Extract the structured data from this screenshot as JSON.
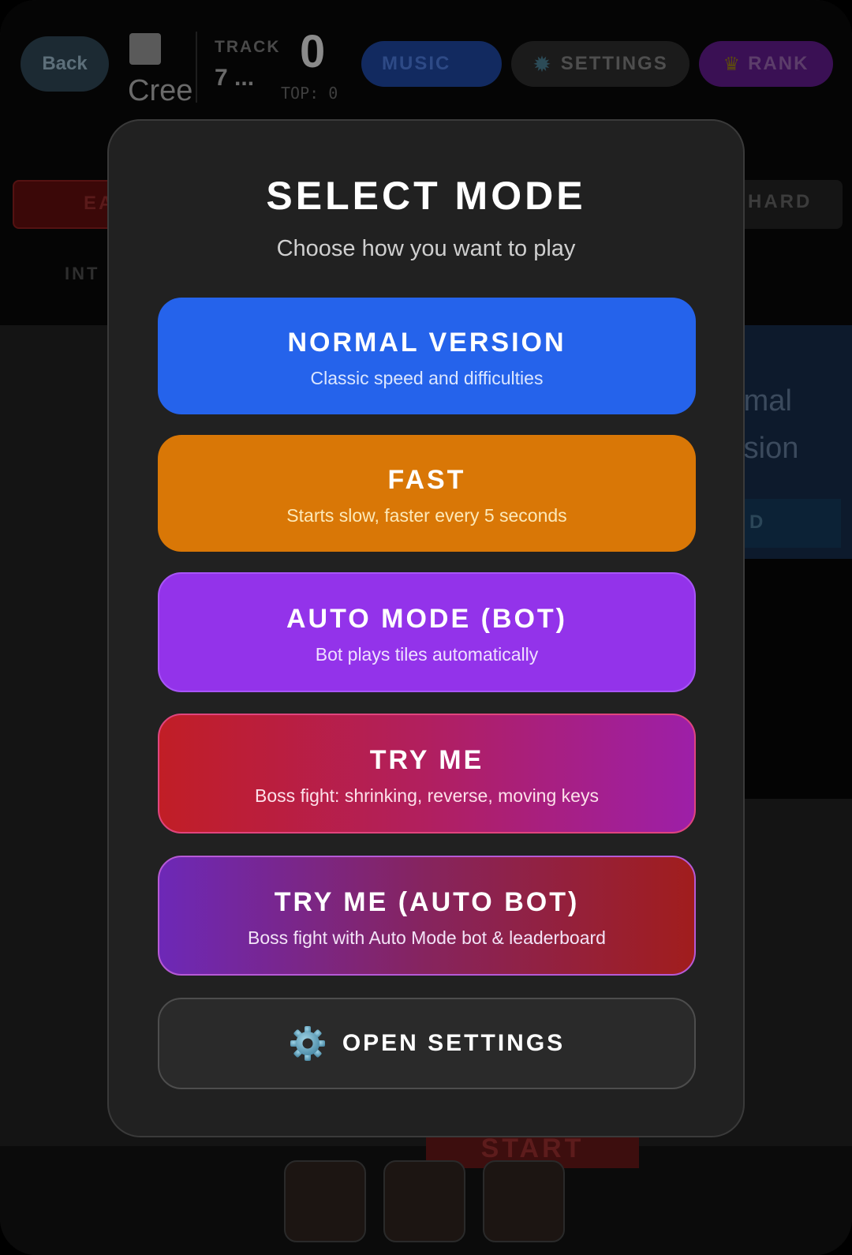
{
  "background": {
    "topbar": {
      "back_label": "Back",
      "song_name": "Cree",
      "track_label": "TRACK",
      "track_number": "7 ...",
      "score": "0",
      "top_score": "TOP: 0",
      "music_label": "MUSIC",
      "settings_label": "SETTINGS",
      "rank_label": "RANK"
    },
    "difficulty": {
      "easy_label": "EA",
      "hard_label": "HARD",
      "intermediate_label": "INT"
    },
    "right_card": {
      "text": "rmal rsion",
      "button_label": "D"
    },
    "start_label": "START"
  },
  "modal": {
    "title": "SELECT MODE",
    "subtitle": "Choose how you want to play",
    "modes": [
      {
        "title": "NORMAL VERSION",
        "desc": "Classic speed and difficulties",
        "color": "#2563eb"
      },
      {
        "title": "FAST",
        "desc": "Starts slow, faster every 5 seconds",
        "color": "#d97706"
      },
      {
        "title": "AUTO MODE (BOT)",
        "desc": "Bot plays tiles automatically",
        "color": "#9333ea"
      },
      {
        "title": "TRY ME",
        "desc": "Boss fight: shrinking, reverse, moving keys",
        "color": "#c11e26"
      },
      {
        "title": "TRY ME (AUTO BOT)",
        "desc": "Boss fight with Auto Mode bot & leaderboard",
        "color": "#6d28b7"
      }
    ],
    "settings_button": {
      "label": "OPEN SETTINGS",
      "icon": "gear-icon"
    }
  }
}
